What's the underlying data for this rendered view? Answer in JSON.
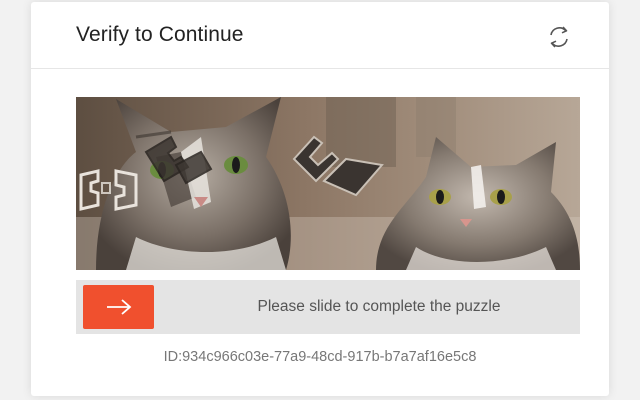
{
  "dialog": {
    "title": "Verify to Continue",
    "refresh_icon": "refresh-icon"
  },
  "puzzle": {
    "image_subject": "two-tabby-cats-photo",
    "piece_icon": "puzzle-piece-icon"
  },
  "slider": {
    "handle_icon": "arrow-right-icon",
    "instruction": "Please slide to complete the puzzle",
    "accent_color": "#f0502e"
  },
  "footer": {
    "id_text": "ID:934c966c03e-77a9-48cd-917b-b7a7af16e5c8"
  }
}
